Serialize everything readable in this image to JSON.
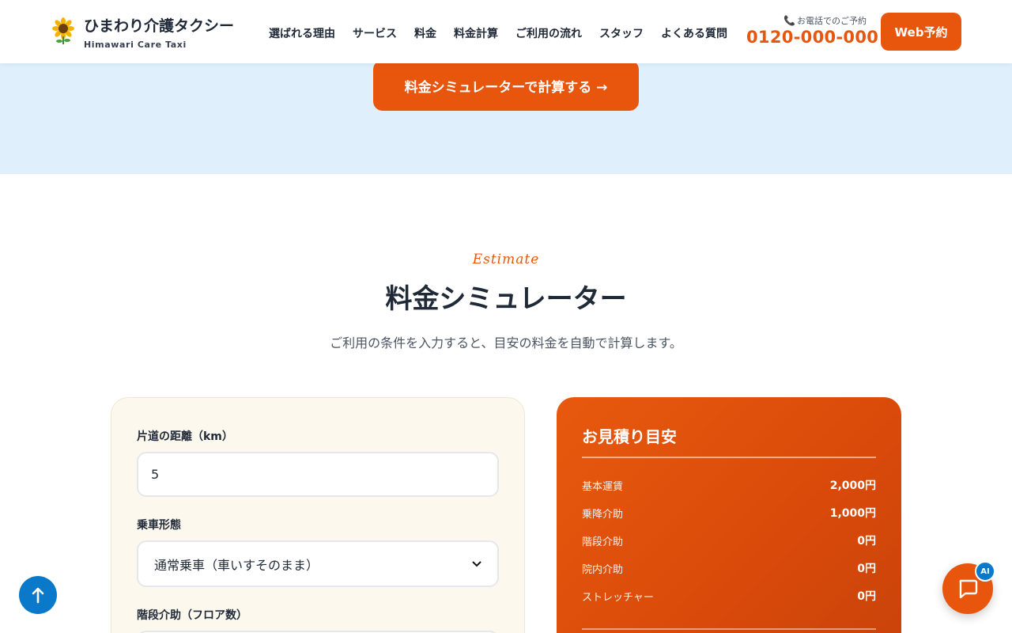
{
  "header": {
    "logo_title": "ひまわり介護タクシー",
    "logo_sub": "Himawari Care Taxi",
    "logo_icon": "sunflower-icon",
    "nav": [
      {
        "label": "選ばれる理由"
      },
      {
        "label": "サービス"
      },
      {
        "label": "料金"
      },
      {
        "label": "料金計算"
      },
      {
        "label": "ご利用の流れ"
      },
      {
        "label": "スタッフ"
      },
      {
        "label": "よくある質問"
      }
    ],
    "phone_label": "お電話でのご予約",
    "phone_icon": "phone-icon",
    "phone_number": "0120-000-000",
    "web_button": "Web予約"
  },
  "hero": {
    "simulator_button": "料金シミュレーターで計算する →"
  },
  "section": {
    "eyebrow": "Estimate",
    "title": "料金シミュレーター",
    "description": "ご利用の条件を入力すると、目安の料金を自動で計算します。"
  },
  "form": {
    "distance_label": "片道の距離（km）",
    "distance_value": "5",
    "ride_type_label": "乗車形態",
    "ride_type_value": "通常乗車（車いすそのまま）",
    "stairs_label": "階段介助（フロア数）"
  },
  "estimate": {
    "title": "お見積り目安",
    "rows": [
      {
        "label": "基本運賃",
        "value": "2,000円"
      },
      {
        "label": "乗降介助",
        "value": "1,000円"
      },
      {
        "label": "階段介助",
        "value": "0円"
      },
      {
        "label": "院内介助",
        "value": "0円"
      },
      {
        "label": "ストレッチャー",
        "value": "0円"
      }
    ]
  },
  "floating": {
    "top_icon": "arrow-up-icon",
    "chat_icon": "chat-icon",
    "ai_badge": "AI"
  },
  "colors": {
    "accent": "#e8560e",
    "blue": "#0a79c9",
    "band": "#dff0fc",
    "form_bg": "#fdf8ee"
  }
}
